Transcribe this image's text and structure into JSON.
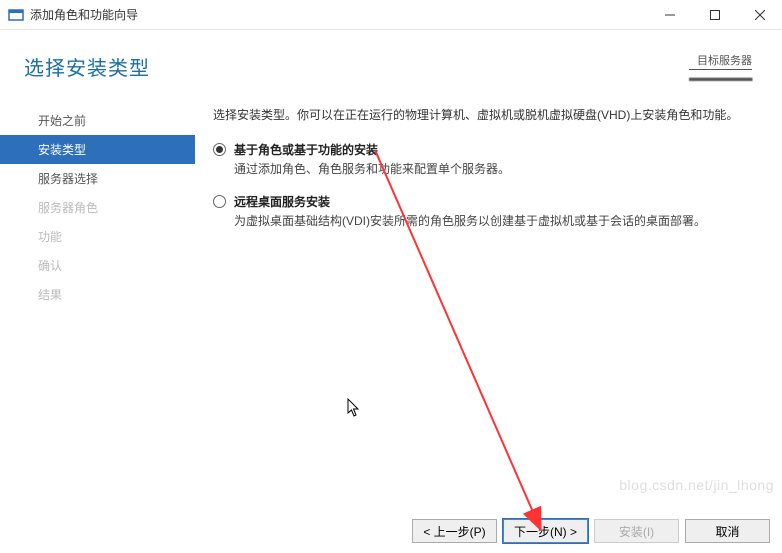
{
  "titlebar": {
    "title": "添加角色和功能向导"
  },
  "header": {
    "page_title": "选择安装类型",
    "target_label": "目标服务器"
  },
  "sidebar": {
    "items": [
      {
        "label": "开始之前",
        "state": "normal"
      },
      {
        "label": "安装类型",
        "state": "active"
      },
      {
        "label": "服务器选择",
        "state": "normal"
      },
      {
        "label": "服务器角色",
        "state": "disabled"
      },
      {
        "label": "功能",
        "state": "disabled"
      },
      {
        "label": "确认",
        "state": "disabled"
      },
      {
        "label": "结果",
        "state": "disabled"
      }
    ]
  },
  "content": {
    "intro": "选择安装类型。你可以在正在运行的物理计算机、虚拟机或脱机虚拟硬盘(VHD)上安装角色和功能。",
    "options": [
      {
        "title": "基于角色或基于功能的安装",
        "desc": "通过添加角色、角色服务和功能来配置单个服务器。",
        "selected": true
      },
      {
        "title": "远程桌面服务安装",
        "desc": "为虚拟桌面基础结构(VDI)安装所需的角色服务以创建基于虚拟机或基于会话的桌面部署。",
        "selected": false
      }
    ]
  },
  "buttons": {
    "prev": "< 上一步(P)",
    "next": "下一步(N) >",
    "install": "安装(I)",
    "cancel": "取消"
  },
  "watermark": "blog.csdn.net/jin_lhong"
}
